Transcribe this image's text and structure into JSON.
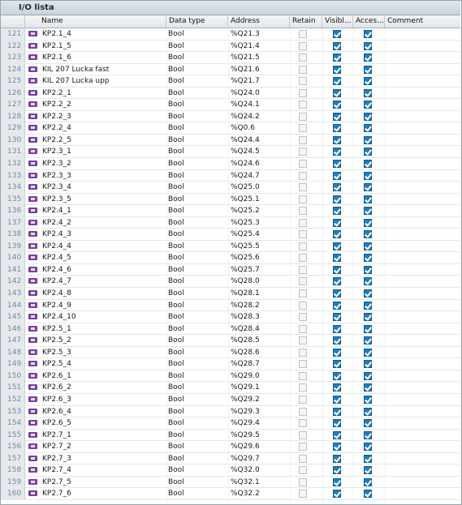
{
  "window": {
    "title": "I/O lista"
  },
  "columns": {
    "name": "Name",
    "type": "Data type",
    "address": "Address",
    "retain": "Retain",
    "visible": "Visibl...",
    "accessible": "Acces...",
    "comment": "Comment"
  },
  "rows": [
    {
      "num": "121",
      "name": "KP2.1_4",
      "type": "Bool",
      "address": "%Q21.3"
    },
    {
      "num": "122",
      "name": "KP2.1_5",
      "type": "Bool",
      "address": "%Q21.4"
    },
    {
      "num": "123",
      "name": "KP2.1_6",
      "type": "Bool",
      "address": "%Q21.5"
    },
    {
      "num": "124",
      "name": "KIL 207 Lucka fast",
      "type": "Bool",
      "address": "%Q21.6"
    },
    {
      "num": "125",
      "name": "KIL 207 Lucka upp",
      "type": "Bool",
      "address": "%Q21.7"
    },
    {
      "num": "126",
      "name": "KP2.2_1",
      "type": "Bool",
      "address": "%Q24.0"
    },
    {
      "num": "127",
      "name": "KP2.2_2",
      "type": "Bool",
      "address": "%Q24.1"
    },
    {
      "num": "128",
      "name": "KP2.2_3",
      "type": "Bool",
      "address": "%Q24.2"
    },
    {
      "num": "129",
      "name": "KP2.2_4",
      "type": "Bool",
      "address": "%Q0.6"
    },
    {
      "num": "130",
      "name": "KP2.2_5",
      "type": "Bool",
      "address": "%Q24.4"
    },
    {
      "num": "131",
      "name": "KP2.3_1",
      "type": "Bool",
      "address": "%Q24.5"
    },
    {
      "num": "132",
      "name": "KP2.3_2",
      "type": "Bool",
      "address": "%Q24.6"
    },
    {
      "num": "133",
      "name": "KP2.3_3",
      "type": "Bool",
      "address": "%Q24.7"
    },
    {
      "num": "134",
      "name": "KP2.3_4",
      "type": "Bool",
      "address": "%Q25.0"
    },
    {
      "num": "135",
      "name": "KP2.3_5",
      "type": "Bool",
      "address": "%Q25.1"
    },
    {
      "num": "136",
      "name": "KP2.4_1",
      "type": "Bool",
      "address": "%Q25.2"
    },
    {
      "num": "137",
      "name": "KP2.4_2",
      "type": "Bool",
      "address": "%Q25.3"
    },
    {
      "num": "138",
      "name": "KP2.4_3",
      "type": "Bool",
      "address": "%Q25.4"
    },
    {
      "num": "139",
      "name": "KP2.4_4",
      "type": "Bool",
      "address": "%Q25.5"
    },
    {
      "num": "140",
      "name": "KP2.4_5",
      "type": "Bool",
      "address": "%Q25.6"
    },
    {
      "num": "141",
      "name": "KP2.4_6",
      "type": "Bool",
      "address": "%Q25.7"
    },
    {
      "num": "142",
      "name": "KP2.4_7",
      "type": "Bool",
      "address": "%Q28.0"
    },
    {
      "num": "143",
      "name": "KP2.4_8",
      "type": "Bool",
      "address": "%Q28.1"
    },
    {
      "num": "144",
      "name": "KP2.4_9",
      "type": "Bool",
      "address": "%Q28.2"
    },
    {
      "num": "145",
      "name": "KP2.4_10",
      "type": "Bool",
      "address": "%Q28.3"
    },
    {
      "num": "146",
      "name": "KP2.5_1",
      "type": "Bool",
      "address": "%Q28.4"
    },
    {
      "num": "147",
      "name": "KP2.5_2",
      "type": "Bool",
      "address": "%Q28.5"
    },
    {
      "num": "148",
      "name": "KP2.5_3",
      "type": "Bool",
      "address": "%Q28.6"
    },
    {
      "num": "149",
      "name": "KP2.5_4",
      "type": "Bool",
      "address": "%Q28.7"
    },
    {
      "num": "150",
      "name": "KP2.6_1",
      "type": "Bool",
      "address": "%Q29.0"
    },
    {
      "num": "151",
      "name": "KP2.6_2",
      "type": "Bool",
      "address": "%Q29.1"
    },
    {
      "num": "152",
      "name": "KP2.6_3",
      "type": "Bool",
      "address": "%Q29.2"
    },
    {
      "num": "153",
      "name": "KP2.6_4",
      "type": "Bool",
      "address": "%Q29.3"
    },
    {
      "num": "154",
      "name": "KP2.6_5",
      "type": "Bool",
      "address": "%Q29.4"
    },
    {
      "num": "155",
      "name": "KP2.7_1",
      "type": "Bool",
      "address": "%Q29.5"
    },
    {
      "num": "156",
      "name": "KP2.7_2",
      "type": "Bool",
      "address": "%Q29.6"
    },
    {
      "num": "157",
      "name": "KP2.7_3",
      "type": "Bool",
      "address": "%Q29.7"
    },
    {
      "num": "158",
      "name": "KP2.7_4",
      "type": "Bool",
      "address": "%Q32.0"
    },
    {
      "num": "159",
      "name": "KP2.7_5",
      "type": "Bool",
      "address": "%Q32.1"
    },
    {
      "num": "160",
      "name": "KP2.7_6",
      "type": "Bool",
      "address": "%Q32.2"
    }
  ],
  "checkbox_defaults": {
    "retain": false,
    "visible": true,
    "accessible": true
  },
  "icons": {
    "tag": "tag-icon"
  },
  "colors": {
    "checked": "#1e7fc2",
    "row_number_bg": "#e4e9ee",
    "tag_icon": "#7a3fa3"
  }
}
